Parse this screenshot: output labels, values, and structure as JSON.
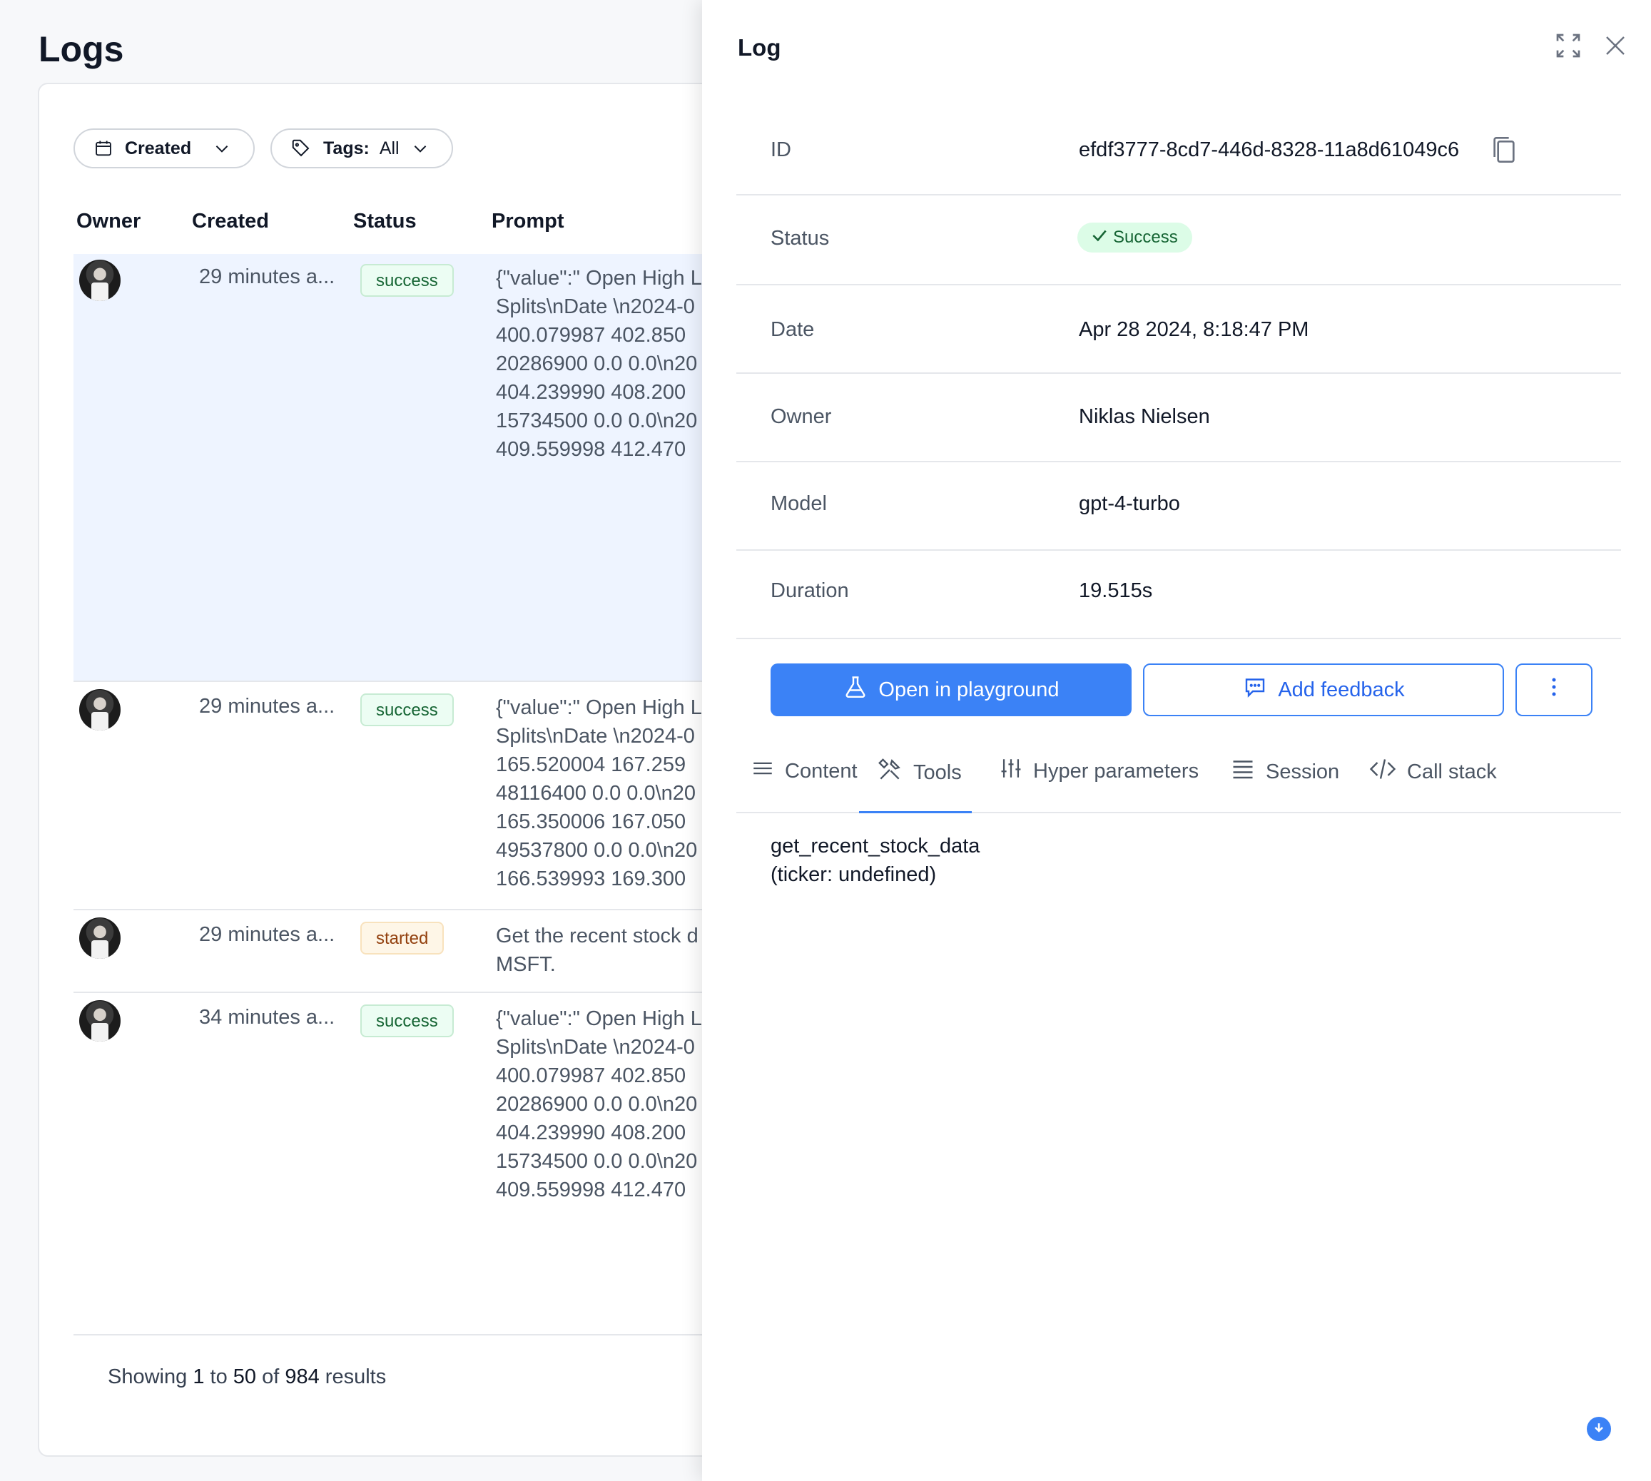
{
  "page": {
    "title": "Logs"
  },
  "filters": {
    "created_label": "Created",
    "tags_label": "Tags:",
    "tags_value": "All"
  },
  "table": {
    "headers": [
      "Owner",
      "Created",
      "Status",
      "Prompt"
    ],
    "rows": [
      {
        "created": "29 minutes a...",
        "status": "success",
        "prompt_lines": [
          "{\"value\":\" Open High L",
          "Splits\\nDate \\n2024-0",
          "400.079987 402.850",
          "20286900 0.0 0.0\\n20",
          "404.239990 408.200",
          "15734500 0.0 0.0\\n20",
          "409.559998 412.470"
        ]
      },
      {
        "created": "29 minutes a...",
        "status": "success",
        "prompt_lines": [
          "{\"value\":\" Open High L",
          "Splits\\nDate \\n2024-0",
          "165.520004 167.259",
          "48116400 0.0 0.0\\n20",
          "165.350006 167.050",
          "49537800 0.0 0.0\\n20",
          "166.539993 169.300"
        ]
      },
      {
        "created": "29 minutes a...",
        "status": "started",
        "prompt_lines": [
          "Get the recent stock d",
          "MSFT."
        ]
      },
      {
        "created": "34 minutes a...",
        "status": "success",
        "prompt_lines": [
          "{\"value\":\" Open High L",
          "Splits\\nDate \\n2024-0",
          "400.079987 402.850",
          "20286900 0.0 0.0\\n20",
          "404.239990 408.200",
          "15734500 0.0 0.0\\n20",
          "409.559998 412.470"
        ]
      }
    ]
  },
  "pagination": {
    "prefix": "Showing",
    "from": "1",
    "to_word": "to",
    "to": "50",
    "of_word": "of",
    "total": "984",
    "suffix": "results"
  },
  "drawer": {
    "title": "Log",
    "details": {
      "id_label": "ID",
      "id_value": "efdf3777-8cd7-446d-8328-11a8d61049c6",
      "status_label": "Status",
      "status_value": "Success",
      "date_label": "Date",
      "date_value": "Apr 28 2024, 8:18:47 PM",
      "owner_label": "Owner",
      "owner_value": "Niklas Nielsen",
      "model_label": "Model",
      "model_value": "gpt-4-turbo",
      "duration_label": "Duration",
      "duration_value": "19.515s"
    },
    "actions": {
      "open_playground": "Open in playground",
      "add_feedback": "Add feedback"
    },
    "tabs": [
      "Content",
      "Tools",
      "Hyper parameters",
      "Session",
      "Call stack"
    ],
    "active_tab": "Tools",
    "tool_call": {
      "name": "get_recent_stock_data",
      "args": "(ticker: undefined)"
    }
  },
  "colors": {
    "accent": "#3b82f6",
    "success_bg": "#ecfdf3",
    "success_text": "#166534",
    "started_bg": "#fef6e7",
    "started_text": "#92400e",
    "selected_row": "#eef4ff"
  },
  "icons": {
    "calendar": "calendar-icon",
    "tag": "tag-icon",
    "chevron": "chevron-down-icon",
    "expand": "expand-icon",
    "close": "close-icon",
    "copy": "copy-icon",
    "check": "check-icon",
    "flask": "flask-icon",
    "chat": "chat-bubble-icon",
    "more": "more-vertical-icon",
    "scroll": "arrow-down-circle-icon"
  }
}
